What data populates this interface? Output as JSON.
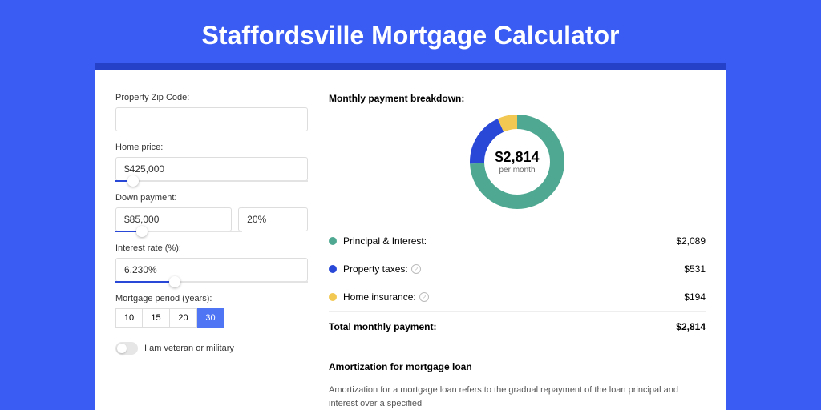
{
  "title": "Staffordsville Mortgage Calculator",
  "form": {
    "zip_label": "Property Zip Code:",
    "zip_value": "",
    "home_price_label": "Home price:",
    "home_price_value": "$425,000",
    "home_price_slider_pct": 9,
    "down_payment_label": "Down payment:",
    "down_payment_value": "$85,000",
    "down_payment_pct": "20%",
    "down_payment_slider_pct": 21,
    "interest_label": "Interest rate (%):",
    "interest_value": "6.230%",
    "interest_slider_pct": 31,
    "period_label": "Mortgage period (years):",
    "periods": [
      "10",
      "15",
      "20",
      "30"
    ],
    "period_selected": "30",
    "veteran_label": "I am veteran or military"
  },
  "breakdown": {
    "title": "Monthly payment breakdown:",
    "center_amount": "$2,814",
    "center_sub": "per month",
    "items": [
      {
        "label": "Principal & Interest:",
        "value": "$2,089",
        "color": "#4fa992",
        "has_info": false
      },
      {
        "label": "Property taxes:",
        "value": "$531",
        "color": "#2948d8",
        "has_info": true
      },
      {
        "label": "Home insurance:",
        "value": "$194",
        "color": "#f2c752",
        "has_info": true
      }
    ],
    "total_label": "Total monthly payment:",
    "total_value": "$2,814"
  },
  "chart_data": {
    "type": "pie",
    "title": "Monthly payment breakdown",
    "series": [
      {
        "name": "Principal & Interest",
        "value": 2089,
        "color": "#4fa992"
      },
      {
        "name": "Property taxes",
        "value": 531,
        "color": "#2948d8"
      },
      {
        "name": "Home insurance",
        "value": 194,
        "color": "#f2c752"
      }
    ],
    "total": 2814,
    "center_label": "$2,814 per month"
  },
  "amortization": {
    "title": "Amortization for mortgage loan",
    "text": "Amortization for a mortgage loan refers to the gradual repayment of the loan principal and interest over a specified"
  }
}
